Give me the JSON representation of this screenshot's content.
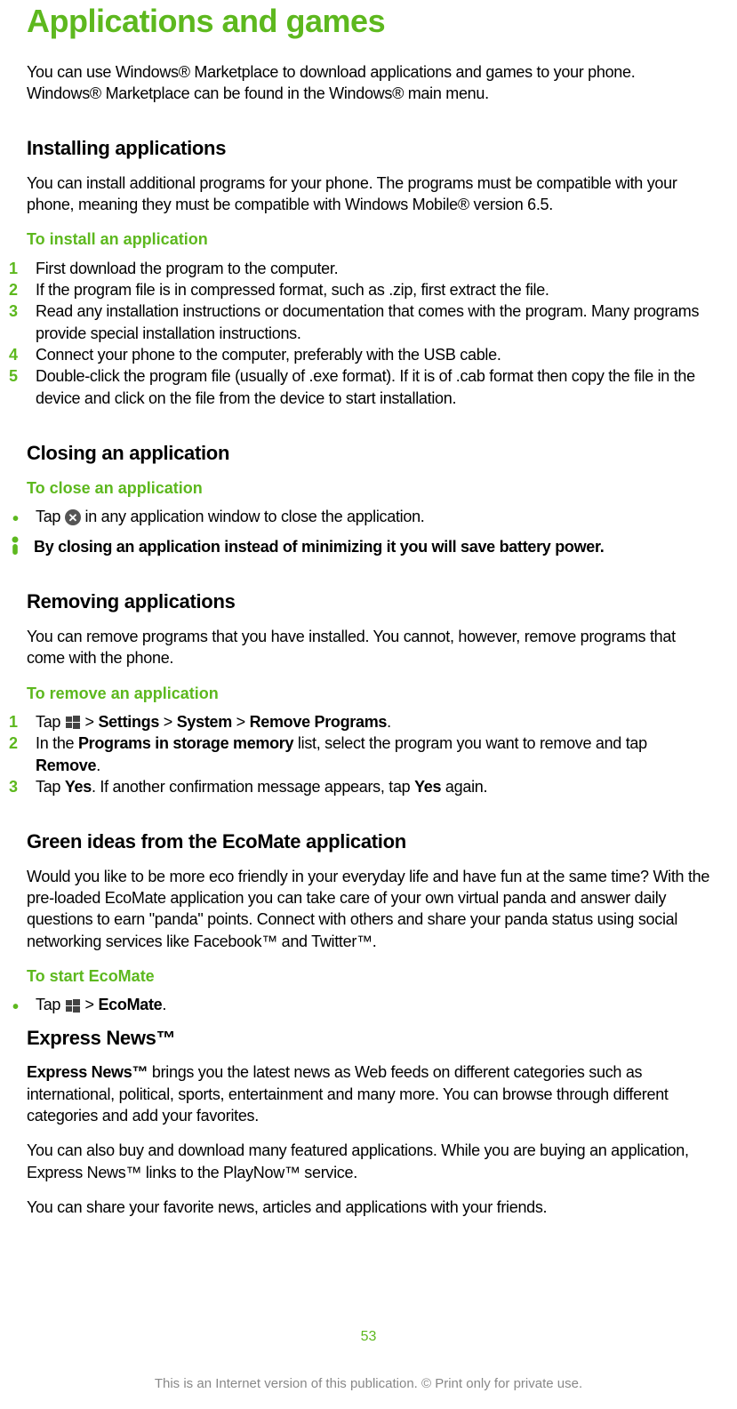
{
  "title": "Applications and games",
  "intro": "You can use Windows® Marketplace to download applications and games to your phone. Windows® Marketplace can be found in the Windows® main menu.",
  "install": {
    "heading": "Installing applications",
    "body": "You can install additional programs for your phone. The programs must be compatible with your phone, meaning they must be compatible with Windows Mobile® version 6.5.",
    "sub": "To install an application",
    "steps": [
      "First download the program to the computer.",
      "If the program file is in compressed format, such as .zip, first extract the file.",
      "Read any installation instructions or documentation that comes with the program. Many programs provide special installation instructions.",
      "Connect your phone to the computer, preferably with the USB cable.",
      "Double-click the program file (usually of .exe format). If it is of .cab format then copy the file in the device and click on the file from the device to start installation."
    ]
  },
  "closing": {
    "heading": "Closing an application",
    "sub": "To close an application",
    "tap_pre": "Tap ",
    "tap_post": " in any application window to close the application.",
    "tip": "By closing an application instead of minimizing it you will save battery power."
  },
  "removing": {
    "heading": "Removing applications",
    "body": "You can remove programs that you have installed. You cannot, however, remove programs that come with the phone.",
    "sub": "To remove an application",
    "step1_pre": "Tap ",
    "step1_gt1": " > ",
    "step1_s": "Settings",
    "step1_gt2": " > ",
    "step1_sys": "System",
    "step1_gt3": " > ",
    "step1_rp": "Remove Programs",
    "step1_end": ".",
    "step2_pre": "In the ",
    "step2_b": "Programs in storage memory",
    "step2_mid": " list, select the program you want to remove and tap ",
    "step2_rem": "Remove",
    "step2_end": ".",
    "step3_pre": "Tap ",
    "step3_yes": "Yes",
    "step3_mid": ". If another confirmation message appears, tap ",
    "step3_yes2": "Yes",
    "step3_end": " again."
  },
  "green": {
    "heading": "Green ideas from the EcoMate application",
    "body": "Would you like to be more eco friendly in your everyday life and have fun at the same time? With the pre-loaded EcoMate application you can take care of your own virtual panda and answer daily questions to earn \"panda\" points. Connect with others and share your panda status using social networking services like Facebook™ and Twitter™.",
    "sub": "To start EcoMate",
    "tap_pre": "Tap ",
    "tap_gt": " > ",
    "tap_eco": "EcoMate",
    "tap_end": "."
  },
  "express": {
    "heading": "Express News™",
    "p1_b": "Express News™",
    "p1": " brings you the latest news as Web feeds on different categories such as international, political, sports, entertainment and many more. You can browse through different categories and add your favorites.",
    "p2": "You can also buy and download many featured applications. While you are buying an application, Express News™ links to the PlayNow™ service.",
    "p3": "You can share your favorite news, articles and applications with your friends."
  },
  "pagenum": "53",
  "footer": "This is an Internet version of this publication. © Print only for private use."
}
